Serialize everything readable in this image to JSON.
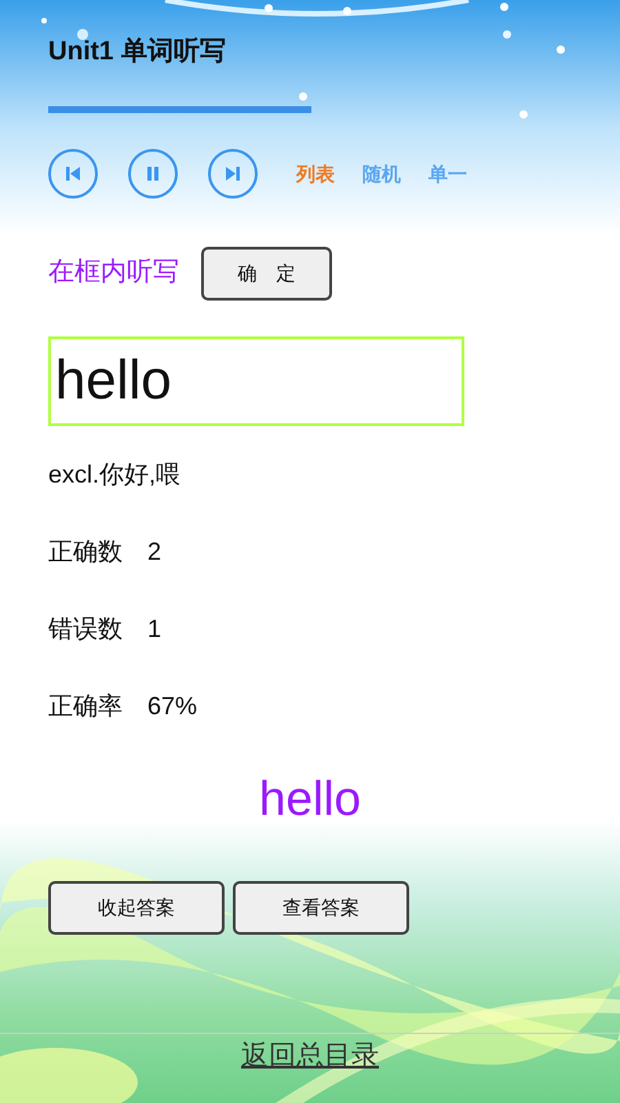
{
  "title": "Unit1 单词听写",
  "player": {
    "buttons": [
      {
        "kind": "previous"
      },
      {
        "kind": "pause"
      },
      {
        "kind": "next"
      }
    ],
    "modes": [
      {
        "label": "列表",
        "selected": true
      },
      {
        "label": "随机",
        "selected": false
      },
      {
        "label": "单一",
        "selected": false
      }
    ]
  },
  "prompt": "在框内听写",
  "confirm_button": "确　定",
  "answer_input": {
    "value": "hello"
  },
  "definition": "excl.你好,喂",
  "stats": [
    {
      "label": "正确数",
      "value": "2"
    },
    {
      "label": "错误数",
      "value": "1"
    },
    {
      "label": "正确率",
      "value": "67%"
    }
  ],
  "answer": "hello",
  "buttons": [
    "收起答案",
    "查看答案"
  ],
  "back_link": "返回总目录"
}
